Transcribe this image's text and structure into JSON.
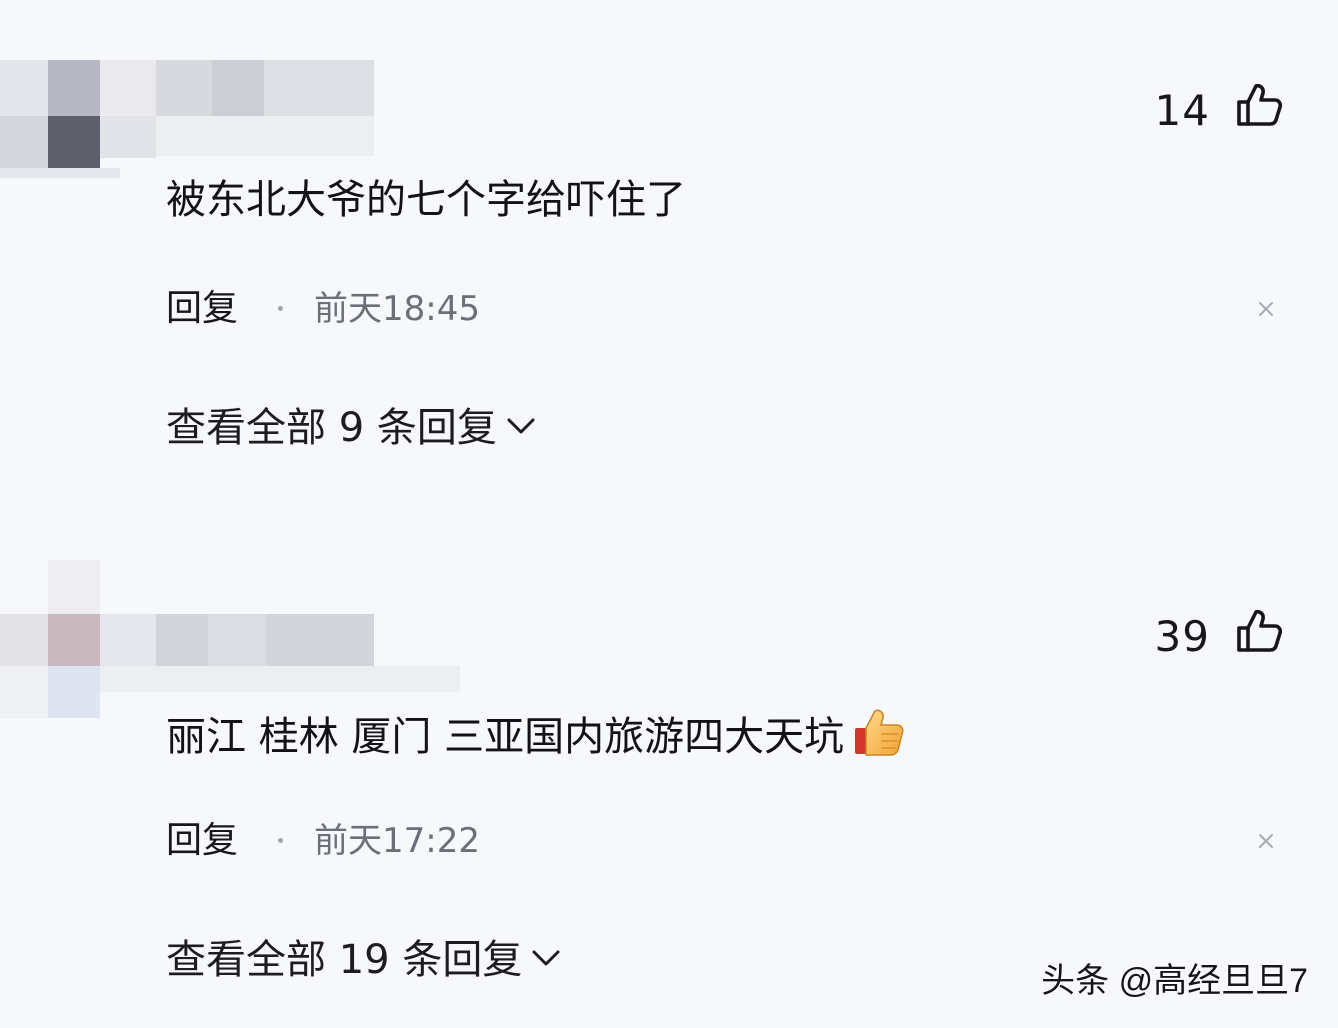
{
  "comments": [
    {
      "like_count": "14",
      "text": "被东北大爷的七个字给吓住了",
      "reply_label": "回复",
      "timestamp": "前天18:45",
      "view_all": "查看全部 9 条回复",
      "has_emoji": false
    },
    {
      "like_count": "39",
      "text": "丽江 桂林 厦门 三亚国内旅游四大天坑",
      "reply_label": "回复",
      "timestamp": "前天17:22",
      "view_all": "查看全部 19 条回复",
      "has_emoji": true,
      "emoji": "thumbs-up"
    }
  ],
  "icons": {
    "like": "thumbs-up-outline-icon",
    "close": "close-icon",
    "expand": "chevron-down-icon"
  },
  "watermark": "头条 @高经旦旦7",
  "colors": {
    "background": "#f7f8fc",
    "text_primary": "#121217",
    "text_secondary": "#6c6e78"
  }
}
